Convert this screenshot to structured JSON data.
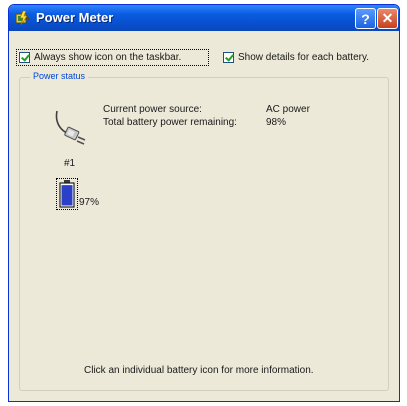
{
  "window": {
    "title": "Power Meter",
    "help_symbol": "?",
    "close_symbol": "✕",
    "title_icon": "power-meter-app-icon"
  },
  "options": {
    "always_show_icon": {
      "label": "Always show icon on the taskbar.",
      "checked": true
    },
    "show_details": {
      "label": "Show details for each battery.",
      "checked": true
    }
  },
  "power_status": {
    "group_label": "Power status",
    "source_label": "Current power source:",
    "source_value": "AC power",
    "remaining_label": "Total battery power remaining:",
    "remaining_value": "98%",
    "icon": "ac-plug-icon"
  },
  "battery": {
    "number": "#1",
    "percent_label": "97%",
    "charge_fraction": 0.97,
    "icon": "battery-icon"
  },
  "footer": {
    "hint": "Click an individual battery icon for more information."
  },
  "colors": {
    "titlebar": "#0a5ce0",
    "window_bg": "#ece9d8",
    "group_label": "#0046d5",
    "battery_fill": "#2b3fc8",
    "checkmark": "#21a121"
  }
}
